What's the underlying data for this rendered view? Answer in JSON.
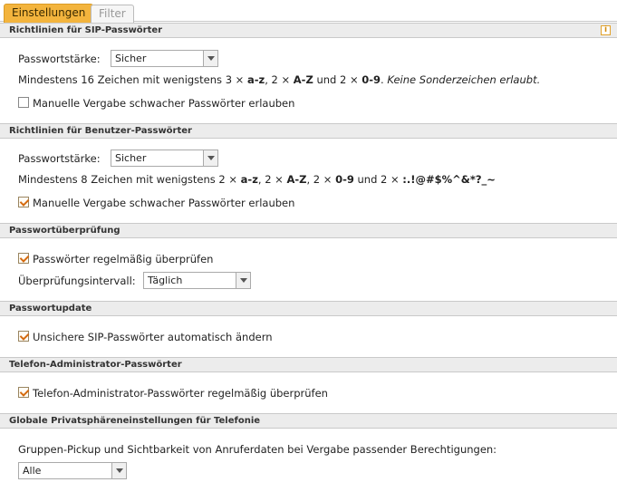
{
  "tabs": {
    "settings": "Einstellungen",
    "filter": "Filter"
  },
  "sip": {
    "header": "Richtlinien für SIP-Passwörter",
    "strength_label": "Passwortstärke:",
    "strength_value": "Sicher",
    "rule_a": "Mindestens 16 Zeichen mit wenigstens 3 × ",
    "rule_b": "a-z",
    "rule_c": ", 2 × ",
    "rule_d": "A-Z",
    "rule_e": " und 2 × ",
    "rule_f": "0-9",
    "rule_g": ". ",
    "rule_h": "Keine Sonderzeichen erlaubt.",
    "manual_label": "Manuelle Vergabe schwacher Passwörter erlauben",
    "manual_checked": false
  },
  "user": {
    "header": "Richtlinien für Benutzer-Passwörter",
    "strength_label": "Passwortstärke:",
    "strength_value": "Sicher",
    "rule_a": "Mindestens 8 Zeichen mit wenigstens 2 × ",
    "rule_b": "a-z",
    "rule_c": ", 2 × ",
    "rule_d": "A-Z",
    "rule_e": ", 2 × ",
    "rule_f": "0-9",
    "rule_g": " und 2 × ",
    "rule_h": ":.!@#$%^&*?_~",
    "manual_label": "Manuelle Vergabe schwacher Passwörter erlauben",
    "manual_checked": true
  },
  "check": {
    "header": "Passwortüberprüfung",
    "regular_label": "Passwörter regelmäßig überprüfen",
    "regular_checked": true,
    "interval_label": "Überprüfungsintervall:",
    "interval_value": "Täglich"
  },
  "update": {
    "header": "Passwortupdate",
    "auto_label": "Unsichere SIP-Passwörter automatisch ändern",
    "auto_checked": true
  },
  "admin": {
    "header": "Telefon-Administrator-Passwörter",
    "check_label": "Telefon-Administrator-Passwörter regelmäßig überprüfen",
    "check_checked": true
  },
  "privacy": {
    "header": "Globale Privatsphäreneinstellungen für Telefonie",
    "pickup_label": "Gruppen-Pickup und Sichtbarkeit von Anruferdaten bei Vergabe passender Berechtigungen:",
    "pickup_value": "Alle"
  },
  "icons": {
    "info": "info-icon"
  },
  "colors": {
    "tab_active": "#f3b43d",
    "checkmark": "#d56a0f"
  }
}
